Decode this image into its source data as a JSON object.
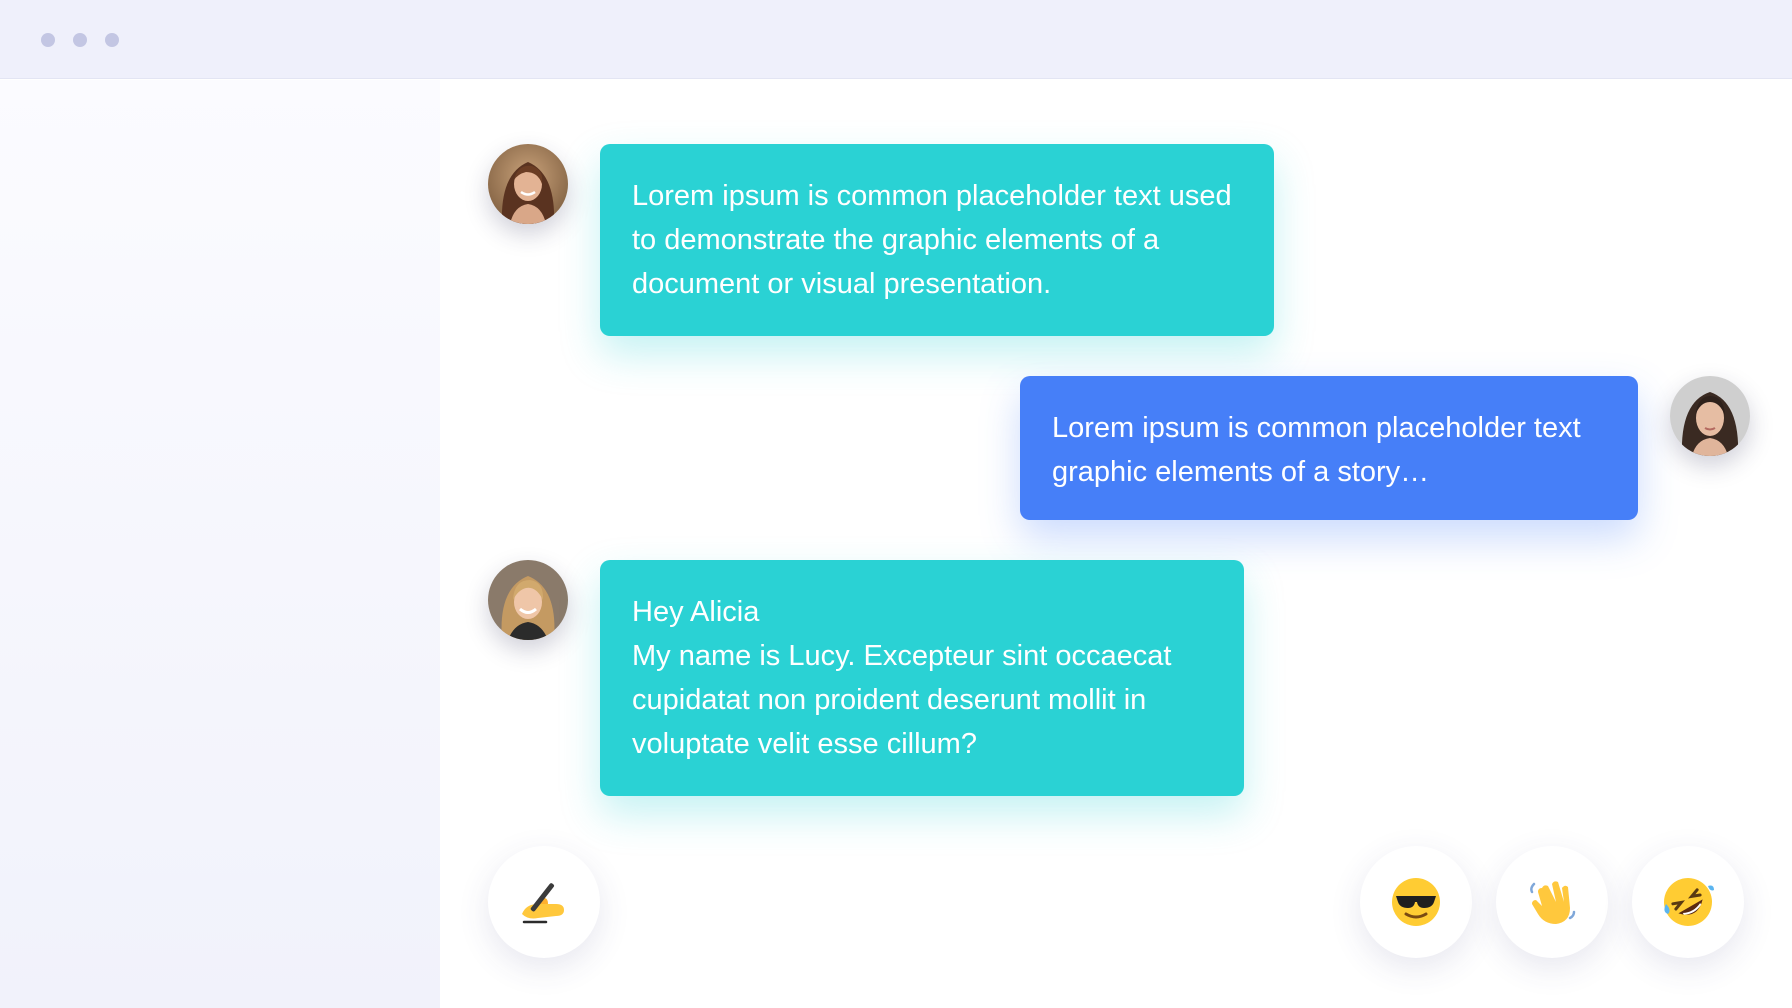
{
  "window": {
    "controls": [
      "dot",
      "dot",
      "dot"
    ]
  },
  "messages": [
    {
      "sender": "left",
      "avatar": "woman-avatar-1",
      "color": "#2ad2d4",
      "text": "Lorem ipsum is common placeholder text used to demonstrate the graphic elements of a document or visual presentation."
    },
    {
      "sender": "right",
      "avatar": "woman-avatar-2",
      "color": "#467ff8",
      "text": "Lorem ipsum is common placeholder text graphic elements of a story…"
    },
    {
      "sender": "left",
      "avatar": "woman-avatar-3",
      "color": "#2ad2d4",
      "line1": "Hey Alicia",
      "text": "My name is Lucy. Excepteur sint occaecat cupidatat non proident deserunt mollit in voluptate velit esse cillum?"
    }
  ],
  "actions": {
    "compose": "writing-hand-emoji",
    "reactions": [
      "sunglasses-emoji",
      "waving-hand-emoji",
      "rolling-laughing-emoji"
    ]
  },
  "colors": {
    "teal": "#2ad2d4",
    "blue": "#467ff8",
    "titlebar": "#eff0fb",
    "dot": "#c3c6e3"
  }
}
